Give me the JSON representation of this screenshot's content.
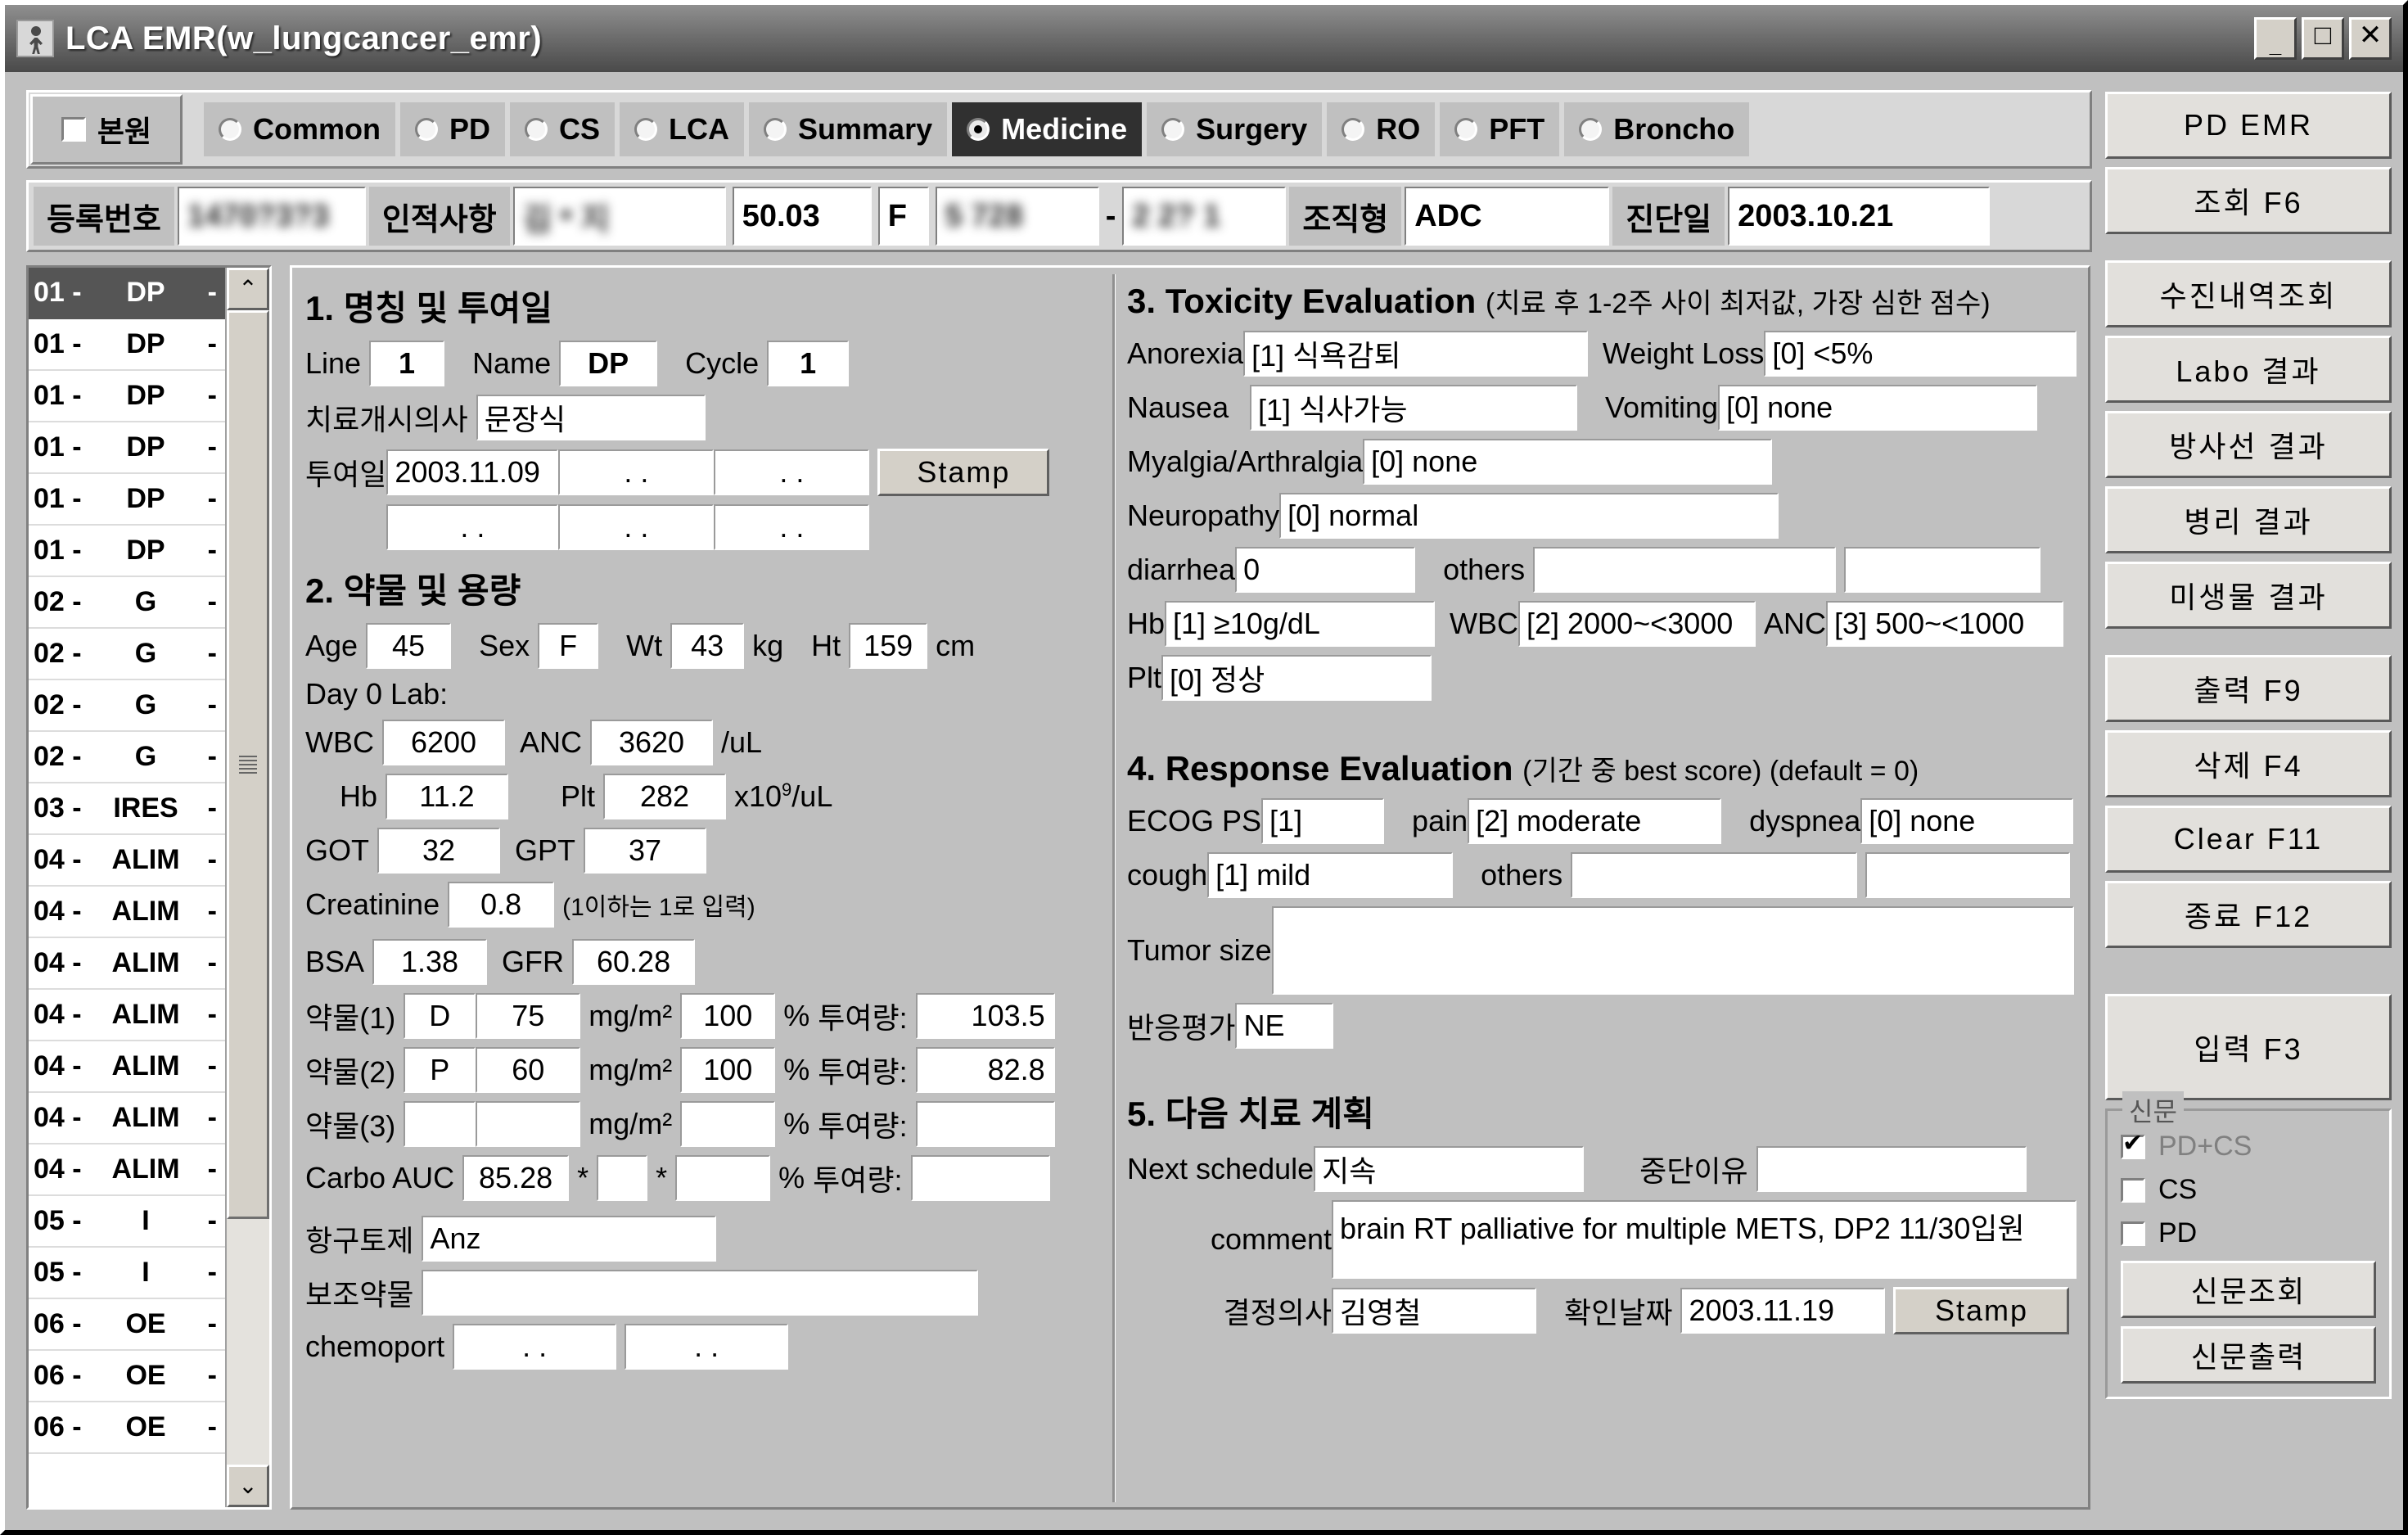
{
  "window": {
    "title": "LCA EMR(w_lungcancer_emr)",
    "minimize": "_",
    "maximize": "□",
    "close": "✕"
  },
  "tabstrip": {
    "bonwon_label": "본원",
    "bonwon_checked": false,
    "tabs": [
      {
        "label": "Common",
        "selected": false
      },
      {
        "label": "PD",
        "selected": false
      },
      {
        "label": "CS",
        "selected": false
      },
      {
        "label": "LCA",
        "selected": false
      },
      {
        "label": "Summary",
        "selected": false
      },
      {
        "label": "Medicine",
        "selected": true
      },
      {
        "label": "Surgery",
        "selected": false
      },
      {
        "label": "RO",
        "selected": false
      },
      {
        "label": "PFT",
        "selected": false
      },
      {
        "label": "Broncho",
        "selected": false
      }
    ]
  },
  "patient": {
    "reg_label": "등록번호",
    "reg_value": "1470?3?3",
    "personal_label": "인적사항",
    "name_value": "김 * 지",
    "age_value": "50.03",
    "sex_value": "F",
    "id1_value": "5  728",
    "dash": "-",
    "id2_value": "2  2?  1",
    "histology_label": "조직형",
    "histology_value": "ADC",
    "dxdate_label": "진단일",
    "dxdate_value": "2003.10.21"
  },
  "list": {
    "items": [
      {
        "no": "01 -",
        "dash1": "",
        "name": "DP",
        "dash2": "-",
        "selected": true
      },
      {
        "no": "01 -",
        "dash1": "",
        "name": "DP",
        "dash2": "-",
        "selected": false
      },
      {
        "no": "01 -",
        "dash1": "",
        "name": "DP",
        "dash2": "-",
        "selected": false
      },
      {
        "no": "01 -",
        "dash1": "",
        "name": "DP",
        "dash2": "-",
        "selected": false
      },
      {
        "no": "01 -",
        "dash1": "",
        "name": "DP",
        "dash2": "-",
        "selected": false
      },
      {
        "no": "01 -",
        "dash1": "",
        "name": "DP",
        "dash2": "-",
        "selected": false
      },
      {
        "no": "02 -",
        "dash1": "",
        "name": "G",
        "dash2": "-",
        "selected": false
      },
      {
        "no": "02 -",
        "dash1": "",
        "name": "G",
        "dash2": "-",
        "selected": false
      },
      {
        "no": "02 -",
        "dash1": "",
        "name": "G",
        "dash2": "-",
        "selected": false
      },
      {
        "no": "02 -",
        "dash1": "",
        "name": "G",
        "dash2": "-",
        "selected": false
      },
      {
        "no": "03 -",
        "dash1": "",
        "name": "IRES",
        "dash2": "-",
        "selected": false
      },
      {
        "no": "04 -",
        "dash1": "",
        "name": "ALIM",
        "dash2": "-",
        "selected": false
      },
      {
        "no": "04 -",
        "dash1": "",
        "name": "ALIM",
        "dash2": "-",
        "selected": false
      },
      {
        "no": "04 -",
        "dash1": "",
        "name": "ALIM",
        "dash2": "-",
        "selected": false
      },
      {
        "no": "04 -",
        "dash1": "",
        "name": "ALIM",
        "dash2": "-",
        "selected": false
      },
      {
        "no": "04 -",
        "dash1": "",
        "name": "ALIM",
        "dash2": "-",
        "selected": false
      },
      {
        "no": "04 -",
        "dash1": "",
        "name": "ALIM",
        "dash2": "-",
        "selected": false
      },
      {
        "no": "04 -",
        "dash1": "",
        "name": "ALIM",
        "dash2": "-",
        "selected": false
      },
      {
        "no": "05 -",
        "dash1": "",
        "name": "I",
        "dash2": "-",
        "selected": false
      },
      {
        "no": "05 -",
        "dash1": "",
        "name": "I",
        "dash2": "-",
        "selected": false
      },
      {
        "no": "06 -",
        "dash1": "",
        "name": "OE",
        "dash2": "-",
        "selected": false
      },
      {
        "no": "06 -",
        "dash1": "",
        "name": "OE",
        "dash2": "-",
        "selected": false
      },
      {
        "no": "06 -",
        "dash1": "",
        "name": "OE",
        "dash2": "-",
        "selected": false
      }
    ],
    "scroll_up": "⌃",
    "scroll_down": "⌄"
  },
  "section1": {
    "heading": "1. 명칭 및 투여일",
    "line_label": "Line",
    "line_value": "1",
    "name_label": "Name",
    "name_value": "DP",
    "cycle_label": "Cycle",
    "cycle_value": "1",
    "doctor_label": "치료개시의사",
    "doctor_value": "문장식",
    "dosedate_label": "투여일",
    "date1": "2003.11.09",
    "date2": ". .",
    "date3": ". .",
    "date4": ". .",
    "date5": ". .",
    "date6": ". .",
    "stamp": "Stamp"
  },
  "section2": {
    "heading": "2. 약물 및 용량",
    "age_label": "Age",
    "age_value": "45",
    "sex_label": "Sex",
    "sex_value": "F",
    "wt_label": "Wt",
    "wt_value": "43",
    "wt_unit": "kg",
    "ht_label": "Ht",
    "ht_value": "159",
    "ht_unit": "cm",
    "day0_label": "Day 0 Lab:",
    "wbc_label": "WBC",
    "wbc_value": "6200",
    "anc_label": "ANC",
    "anc_value": "3620",
    "anc_unit": "/uL",
    "hb_label": "Hb",
    "hb_value": "11.2",
    "plt_label": "Plt",
    "plt_value": "282",
    "plt_unit": "x10",
    "plt_unit_sup": "9",
    "plt_unit_tail": "/uL",
    "got_label": "GOT",
    "got_value": "32",
    "gpt_label": "GPT",
    "gpt_value": "37",
    "creatinine_label": "Creatinine",
    "creatinine_value": "0.8",
    "creatinine_note": "(1이하는 1로 입력)",
    "bsa_label": "BSA",
    "bsa_value": "1.38",
    "gfr_label": "GFR",
    "gfr_value": "60.28",
    "mgm2": "mg/m²",
    "pct": "%",
    "dose_label": "투여량:",
    "drugs": [
      {
        "label": "약물(1)",
        "code": "D",
        "dose": "75",
        "percent": "100",
        "total": "103.5"
      },
      {
        "label": "약물(2)",
        "code": "P",
        "dose": "60",
        "percent": "100",
        "total": "82.8"
      },
      {
        "label": "약물(3)",
        "code": "",
        "dose": "",
        "percent": "",
        "total": ""
      }
    ],
    "carbo_label": "Carbo AUC",
    "carbo_value": "85.28",
    "carbo_star1": "*",
    "carbo_v2": "",
    "carbo_star2": "*",
    "carbo_pct": "",
    "carbo_total": "",
    "antiemetic_label": "항구토제",
    "antiemetic_value": "Anz",
    "adjuvant_label": "보조약물",
    "adjuvant_value": "",
    "chemoport_label": "chemoport",
    "chemoport1": ". .",
    "chemoport2": ". ."
  },
  "section3": {
    "heading": "3. Toxicity Evaluation",
    "heading_sub": "(치료 후 1-2주 사이 최저값, 가장 심한 점수)",
    "anorexia_label": "Anorexia",
    "anorexia_value": "[1] 식욕감퇴",
    "weightloss_label": "Weight Loss",
    "weightloss_value": "[0] <5%",
    "nausea_label": "Nausea",
    "nausea_value": "[1] 식사가능",
    "vomiting_label": "Vomiting",
    "vomiting_value": "[0] none",
    "myalgia_label": "Myalgia/Arthralgia",
    "myalgia_value": "[0] none",
    "neuropathy_label": "Neuropathy",
    "neuropathy_value": "[0] normal",
    "diarrhea_label": "diarrhea",
    "diarrhea_value": "0",
    "others_label": "others",
    "others_value1": "",
    "others_value2": "",
    "hb_label": "Hb",
    "hb_value": "[1] ≥10g/dL",
    "wbc_label": "WBC",
    "wbc_value": "[2] 2000~<3000",
    "anc_label": "ANC",
    "anc_value": "[3] 500~<1000",
    "plt_label": "Plt",
    "plt_value": "[0] 정상"
  },
  "section4": {
    "heading": "4. Response Evaluation",
    "heading_sub": "(기간 중 best score) (default = 0)",
    "ecog_label": "ECOG PS",
    "ecog_value": "[1]",
    "pain_label": "pain",
    "pain_value": "[2] moderate",
    "dyspnea_label": "dyspnea",
    "dyspnea_value": "[0] none",
    "cough_label": "cough",
    "cough_value": "[1] mild",
    "others_label": "others",
    "others_value1": "",
    "others_value2": "",
    "tumorsize_label": "Tumor size",
    "tumorsize_value": "",
    "response_label": "반응평가",
    "response_value": "NE"
  },
  "section5": {
    "heading": "5. 다음 치료 계획",
    "next_label": "Next schedule",
    "next_value": "지속",
    "stopreason_label": "중단이유",
    "stopreason_value": "",
    "comment_label": "comment",
    "comment_value": "brain RT palliative for multiple METS, DP2 11/30입원",
    "decider_label": "결정의사",
    "decider_value": "김영철",
    "confirmdate_label": "확인날짜",
    "confirmdate_value": "2003.11.19",
    "stamp": "Stamp"
  },
  "rightbar": {
    "buttons_top": [
      "PD EMR",
      "조회 F6"
    ],
    "buttons_mid": [
      "수진내역조회",
      "Labo 결과",
      "방사선 결과",
      "병리 결과",
      "미생물 결과"
    ],
    "buttons_act": [
      "출력 F9",
      "삭제 F4",
      "Clear F11",
      "종료 F12"
    ],
    "input_button": "입력 F3",
    "group_title": "신문",
    "checks": [
      {
        "label": "PD+CS",
        "checked": true,
        "dim": true
      },
      {
        "label": "CS",
        "checked": false,
        "dim": false
      },
      {
        "label": "PD",
        "checked": false,
        "dim": false
      }
    ],
    "group_buttons": [
      "신문조회",
      "신문출력"
    ]
  }
}
